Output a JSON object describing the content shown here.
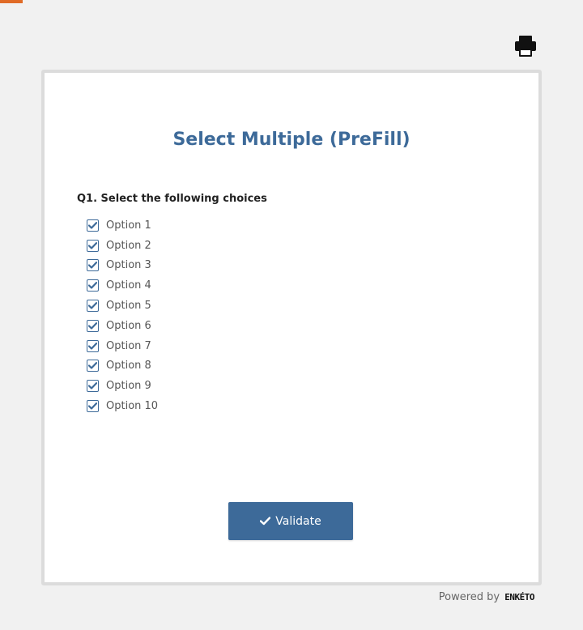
{
  "form": {
    "title": "Select Multiple (PreFill)",
    "question": {
      "label": "Q1. Select the following choices",
      "options": [
        {
          "label": "Option 1",
          "checked": true
        },
        {
          "label": "Option 2",
          "checked": true
        },
        {
          "label": "Option 3",
          "checked": true
        },
        {
          "label": "Option 4",
          "checked": true
        },
        {
          "label": "Option 5",
          "checked": true
        },
        {
          "label": "Option 6",
          "checked": true
        },
        {
          "label": "Option 7",
          "checked": true
        },
        {
          "label": "Option 8",
          "checked": true
        },
        {
          "label": "Option 9",
          "checked": true
        },
        {
          "label": "Option 10",
          "checked": true
        }
      ]
    },
    "validate_label": "Validate"
  },
  "footer": {
    "powered_by": "Powered by",
    "brand": "ENKÉTO"
  },
  "icons": {
    "print": "print-icon",
    "checkbox_check": "checkmark-icon",
    "validate": "checkmark-icon"
  },
  "colors": {
    "accent": "#3d6a99",
    "corner": "#e06b26",
    "background": "#f1f1f1",
    "card_border": "#dcdcdc"
  }
}
